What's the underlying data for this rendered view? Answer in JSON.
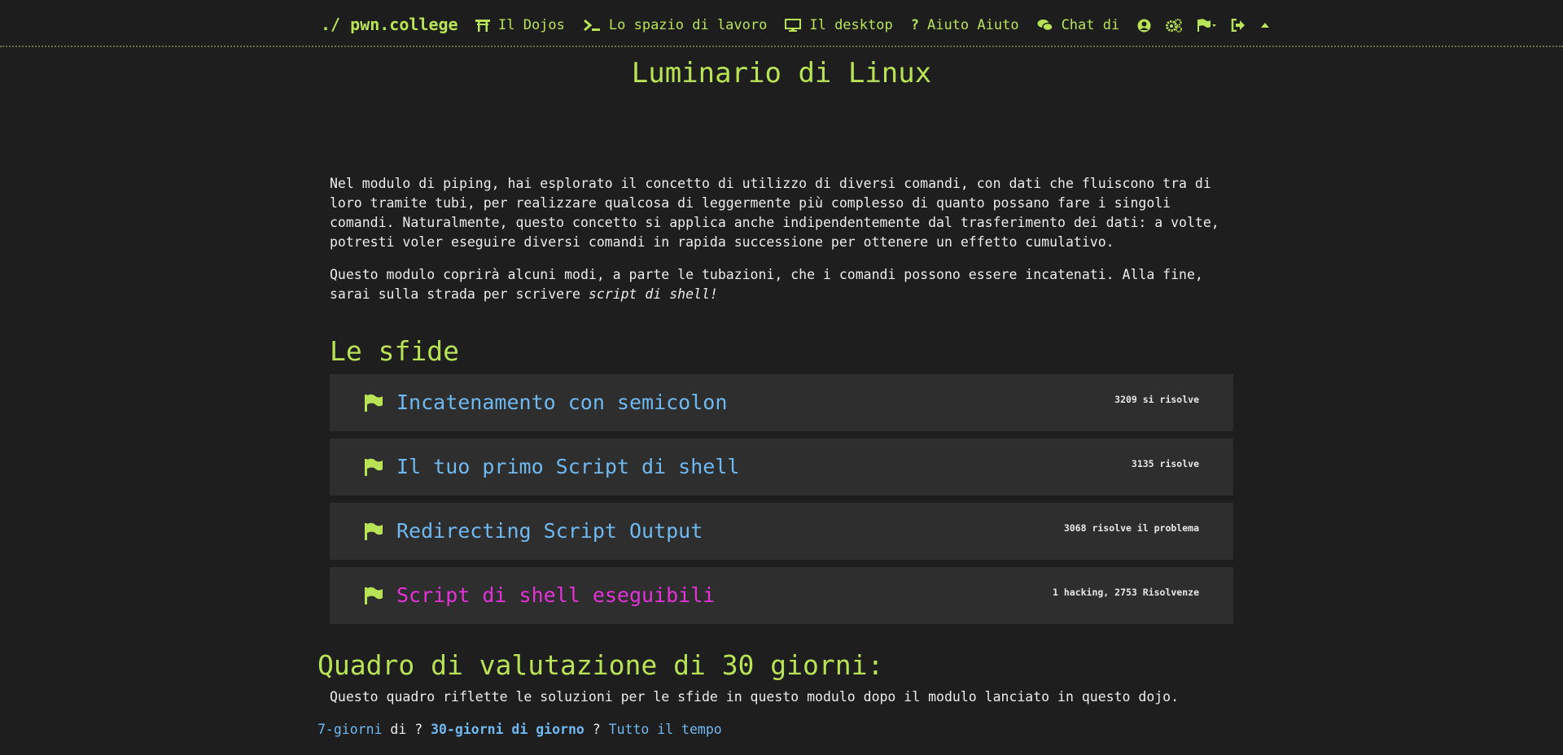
{
  "nav": {
    "brand": "./ pwn.college",
    "items": [
      {
        "label": "Il Dojos",
        "icon": "torii-gate-icon"
      },
      {
        "label": "Lo spazio di lavoro",
        "icon": "terminal-icon"
      },
      {
        "label": "Il desktop",
        "icon": "desktop-icon"
      },
      {
        "label": "Aiuto Aiuto",
        "icon": "question-icon"
      },
      {
        "label": "Chat di",
        "icon": "comments-icon"
      }
    ],
    "icon_buttons": [
      "user-circle-icon",
      "cogs-icon",
      "flag-dropdown-icon",
      "sign-out-icon",
      "caret-up-icon"
    ]
  },
  "page": {
    "title": "Luminario di Linux",
    "paragraph1": "Nel modulo di piping, hai esplorato il concetto di utilizzo di diversi comandi, con dati che fluiscono tra di loro tramite tubi, per realizzare qualcosa di leggermente più complesso di quanto possano fare i singoli comandi. Naturalmente, questo concetto si applica anche indipendentemente dal trasferimento dei dati: a volte, potresti voler eseguire diversi comandi in rapida successione per ottenere un effetto cumulativo.",
    "paragraph2_start": "Questo modulo coprirà alcuni modi, a parte le tubazioni, che i comandi possono essere incatenati. Alla fine, sarai sulla strada per scrivere ",
    "paragraph2_em": "script di shell!",
    "challenges_heading": "Le sfide"
  },
  "challenges": [
    {
      "name": "Incatenamento con semicolon",
      "solves": "3209 si risolve",
      "state": "normal"
    },
    {
      "name": "Il tuo primo Script di shell",
      "solves": "3135 risolve",
      "state": "normal"
    },
    {
      "name": "Redirecting Script Output",
      "solves": "3068 risolve il problema",
      "state": "normal"
    },
    {
      "name": "Script di shell eseguibili",
      "solves": "1 hacking, 2753 Risolvenze",
      "state": "hacking"
    }
  ],
  "scoreboard": {
    "title": "Quadro di valutazione di 30 giorni:",
    "description": "Questo quadro riflette le soluzioni per le sfide in questo modulo dopo il modulo lanciato in questo dojo.",
    "range_7": "7-giorni",
    "sep1": " di ? ",
    "range_30": "30-giorni di giorno",
    "sep2": " ? ",
    "range_all": "Tutto il tempo"
  },
  "colors": {
    "accent": "#b8e356",
    "link": "#6fb8f0",
    "hacking": "#e332d8",
    "background": "#1e1e1e",
    "card": "#2e2e2e"
  }
}
